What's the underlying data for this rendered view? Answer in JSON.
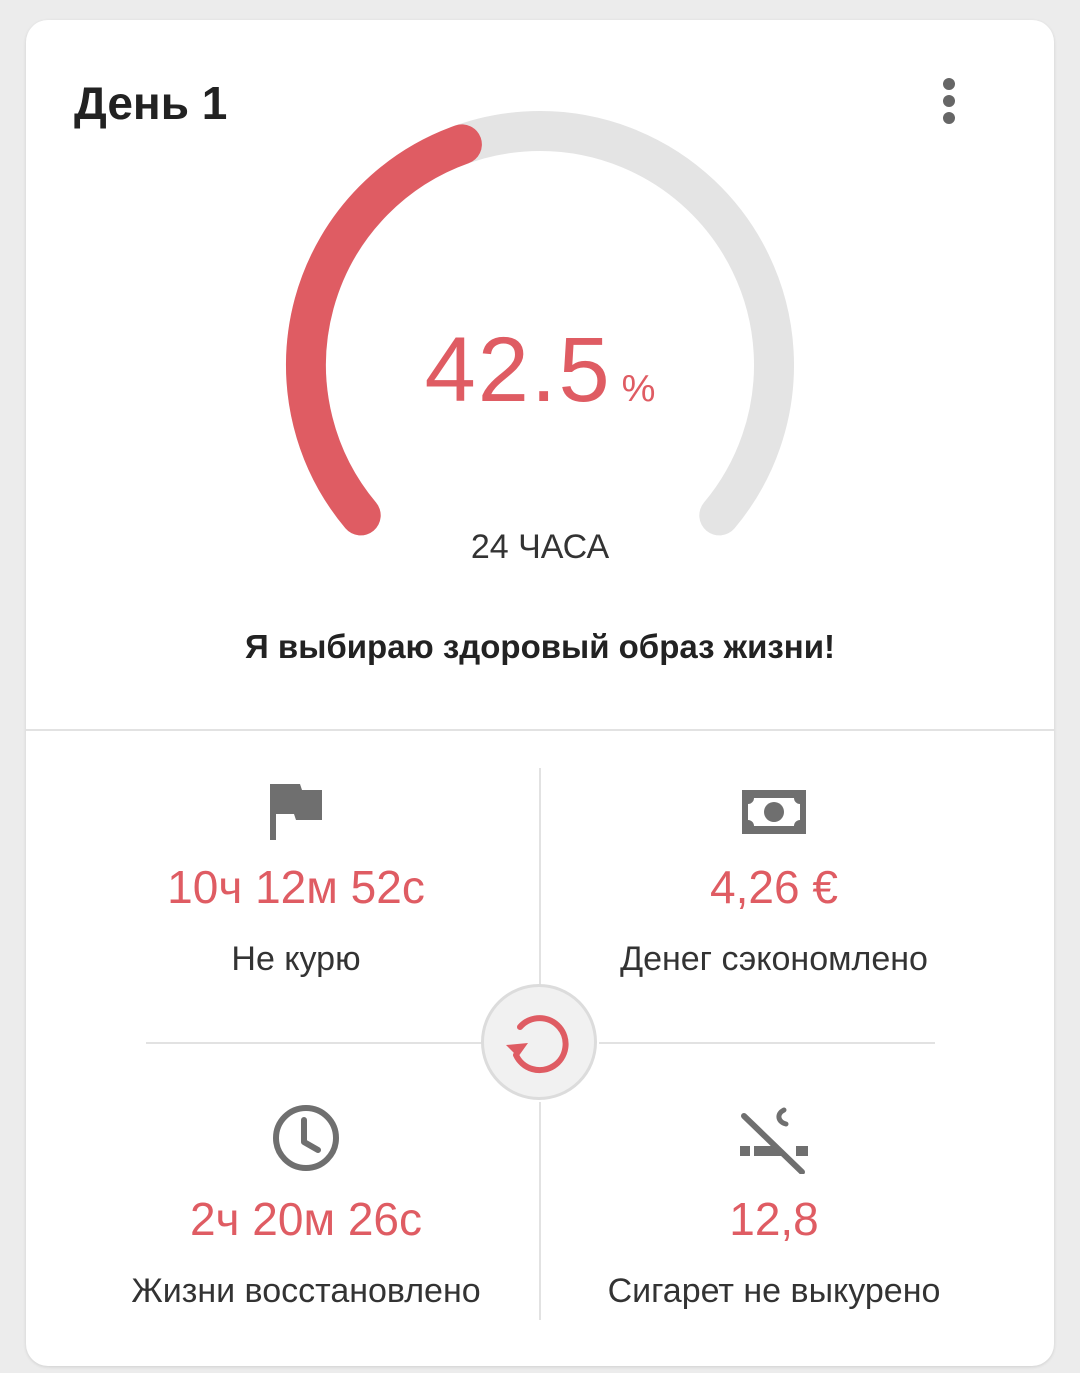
{
  "card": {
    "title": "День 1",
    "menu_icon": "more-vertical-icon"
  },
  "gauge": {
    "progress_percent": 42.5,
    "value": "42.5",
    "unit": "%",
    "label": "24 ЧАСА",
    "colors": {
      "progress": "#df5c63",
      "track": "#e4e4e4"
    }
  },
  "motto": "Я выбираю здоровый образ жизни!",
  "stats": [
    {
      "icon": "flag-icon",
      "value": "10ч 12м 52с",
      "label": "Не курю"
    },
    {
      "icon": "money-icon",
      "value": "4,26 €",
      "label": "Денег сэкономлено"
    },
    {
      "icon": "clock-icon",
      "value": "2ч 20м 26с",
      "label": "Жизни восстановлено"
    },
    {
      "icon": "no-smoking-icon",
      "value": "12,8",
      "label": "Сигарет не выкурено"
    }
  ],
  "reset_icon": "reset-icon"
}
